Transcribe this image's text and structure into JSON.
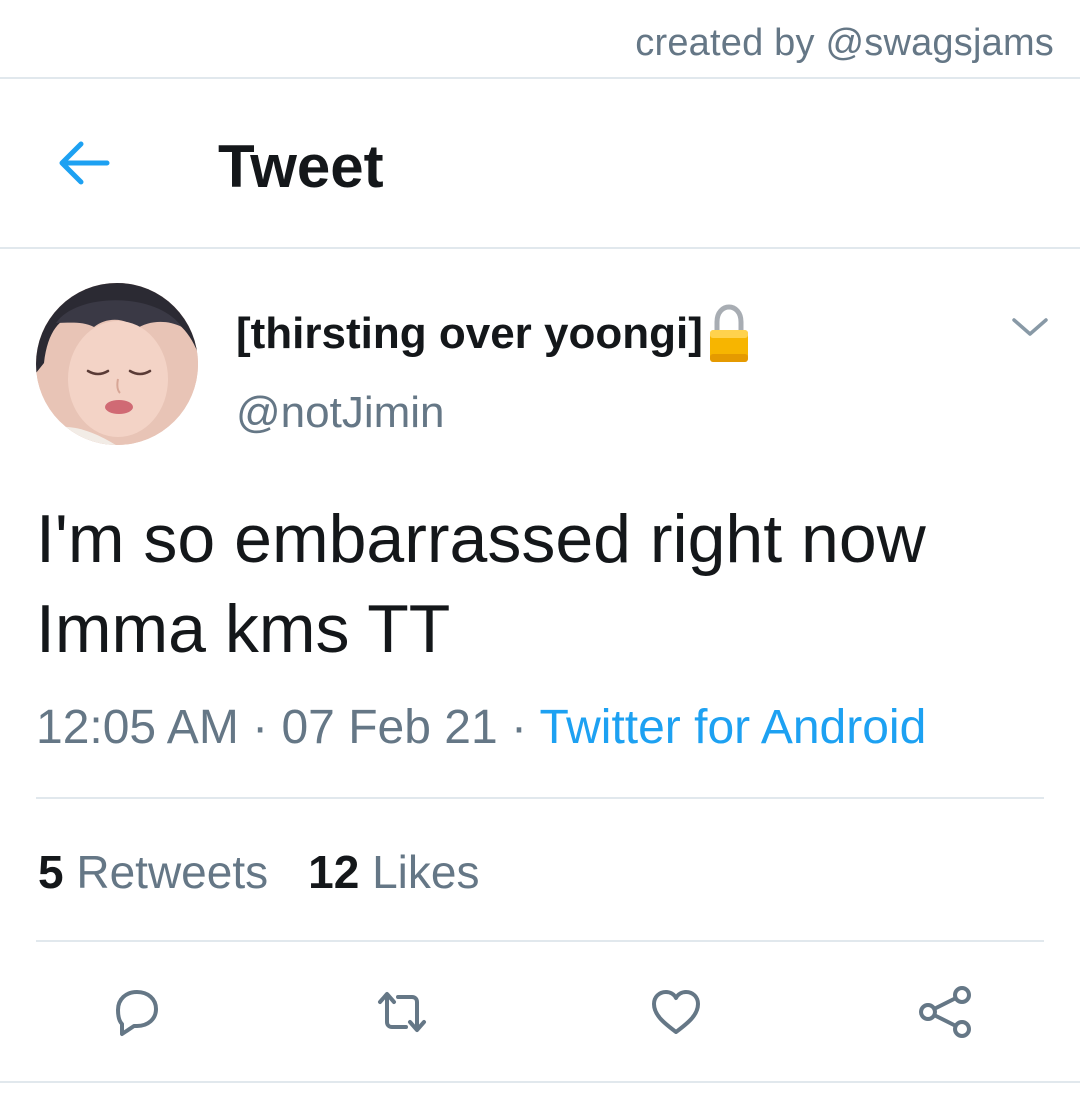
{
  "watermark": "created by @swagsjams",
  "header": {
    "title": "Tweet",
    "back_icon": "arrow-left-icon"
  },
  "tweet": {
    "display_name": "[thirsting over yoongi]",
    "protected_icon": "lock-icon",
    "handle": "@notJimin",
    "text_line1": "I'm so embarrassed right now",
    "text_line2": "Imma kms TT",
    "time": "12:05 AM",
    "sep1": " · ",
    "date": "07 Feb 21",
    "sep2": " · ",
    "source": "Twitter for Android"
  },
  "stats": {
    "retweets_count": "5",
    "retweets_label": "Retweets",
    "likes_count": "12",
    "likes_label": "Likes"
  },
  "actions": [
    "reply-icon",
    "retweet-icon",
    "like-icon",
    "share-icon"
  ],
  "colors": {
    "accent": "#1da1f2",
    "text": "#14171a",
    "secondary": "#657786",
    "divider": "#e1e8ed",
    "lock": "#f7b500"
  }
}
